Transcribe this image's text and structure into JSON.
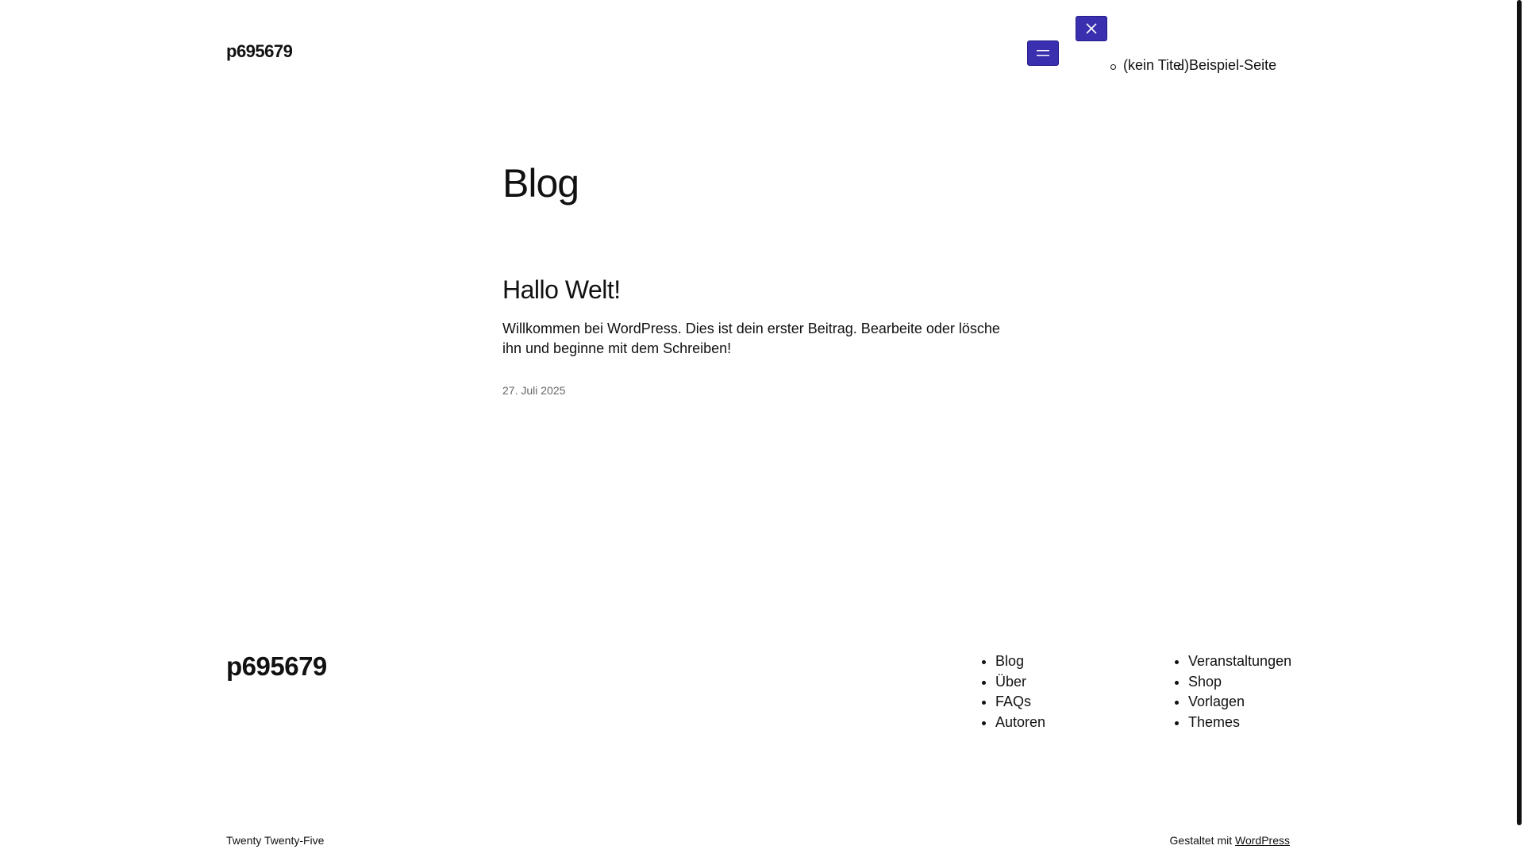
{
  "header": {
    "site_title": "p695679",
    "nav_items": [
      {
        "label": "(kein Titel)"
      },
      {
        "label": "Beispiel-Seite"
      }
    ]
  },
  "main": {
    "heading": "Blog",
    "post": {
      "title": "Hallo Welt!",
      "excerpt": "Willkommen bei WordPress. Dies ist dein erster Beitrag. Bearbeite oder lösche ihn und beginne mit dem Schreiben!",
      "date": "27. Juli 2025"
    }
  },
  "footer": {
    "site_title": "p695679",
    "nav_col1": [
      {
        "label": "Blog"
      },
      {
        "label": "Über"
      },
      {
        "label": "FAQs"
      },
      {
        "label": "Autoren"
      }
    ],
    "nav_col2": [
      {
        "label": "Veranstaltungen"
      },
      {
        "label": "Shop"
      },
      {
        "label": "Vorlagen"
      },
      {
        "label": "Themes"
      }
    ],
    "theme_credit": "Twenty Twenty-Five",
    "powered_prefix": "Gestaltet mit ",
    "powered_link": "WordPress"
  },
  "icons": {
    "menu": "hamburger-icon",
    "close": "close-icon"
  },
  "colors": {
    "button_bg": "#3a2fae",
    "text": "#111111",
    "date": "#666666"
  }
}
